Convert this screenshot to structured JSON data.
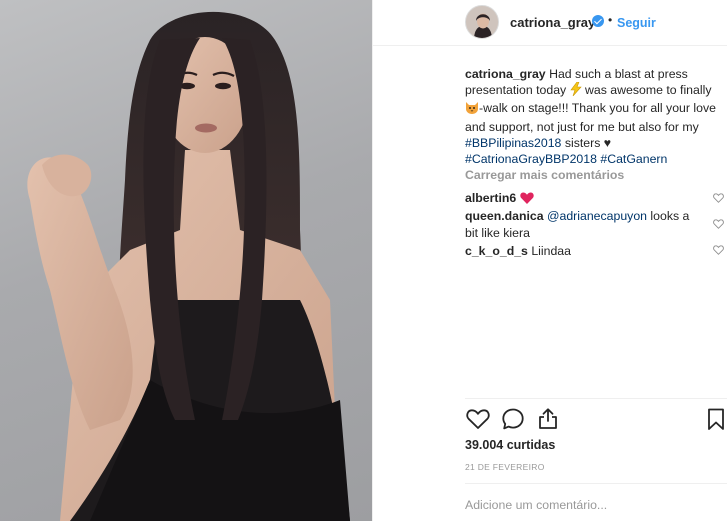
{
  "post": {
    "username": "catriona_gray",
    "dot": "•",
    "follow_label": "Seguir",
    "caption": {
      "username": "catriona_gray",
      "part1": " Had such a blast at press presentation today ",
      "emoji1": "lightning-emoji",
      "part2": " was awesome to finally ",
      "emoji2": "cat-emoji",
      "part3": "-walk on stage!!! Thank you for all your love and support, not just for me but also for my ",
      "tag1": "#BBPilipinas2018",
      "part4": " sisters ",
      "heart": "♥",
      "tag2": "#CatrionaGrayBBP2018",
      "tag3": "#CatGanern"
    },
    "load_more_label": "Carregar mais comentários",
    "comments": [
      {
        "username": "albertin6",
        "text": "",
        "emoji": "red-heart-emoji"
      },
      {
        "username": "queen.danica",
        "mention": "@adrianecapuyon",
        "text": " looks a bit like kiera"
      },
      {
        "username": "c_k_o_d_s",
        "text": " Liindaa"
      }
    ],
    "likes": "39.004 curtidas",
    "date": "21 DE FEVEREIRO",
    "add_comment_placeholder": "Adicione um comentário..."
  },
  "icons": [
    "verified-icon",
    "like-icon",
    "comment-icon",
    "share-icon",
    "save-icon",
    "heart-outline-icon"
  ],
  "colors": {
    "link": "#3897f0",
    "hashtag": "#003569",
    "muted": "#999999",
    "text": "#262626",
    "heart": "#ed4956"
  }
}
